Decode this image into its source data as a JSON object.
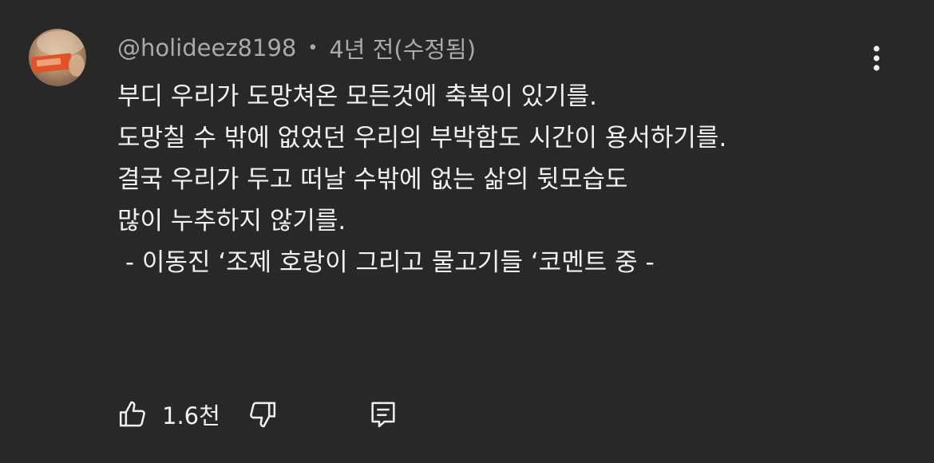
{
  "comment": {
    "author": "@holideez8198",
    "separator": "•",
    "timestamp": "4년 전(수정됨)",
    "text": "부디 우리가 도망쳐온 모든것에 축복이 있기를.\n도망칠 수 밖에 없었던 우리의 부박함도 시간이 용서하기를.\n결국 우리가 두고 떠날 수밖에 없는 삶의 뒷모습도\n많이 누추하지 않기를.\n - 이동진 ‘조제 호랑이 그리고 물고기들 ‘코멘트 중 -",
    "like_count": "1.6천"
  },
  "icons": {
    "avatar": "avatar",
    "more": "more-vert-icon",
    "like": "thumbs-up-icon",
    "dislike": "thumbs-down-icon",
    "reply": "reply-comment-icon"
  },
  "colors": {
    "background": "#282828",
    "text": "#f1f1f1",
    "secondary_text": "#aaaaaa"
  }
}
